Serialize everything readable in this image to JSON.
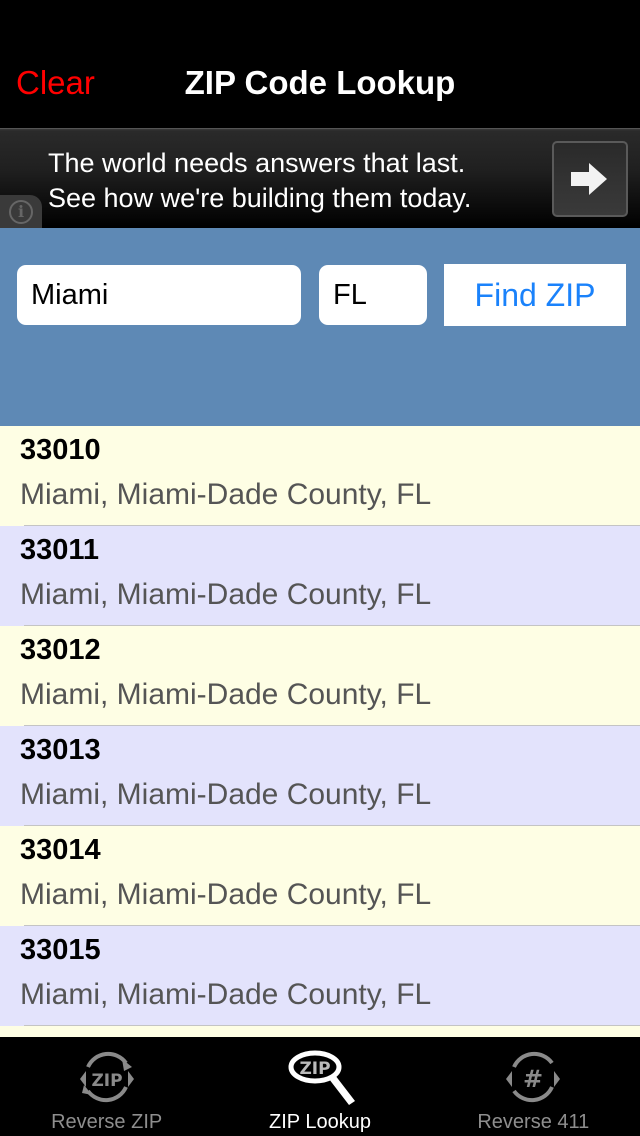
{
  "header": {
    "clear_label": "Clear",
    "title": "ZIP Code Lookup"
  },
  "ad": {
    "line1": "The world needs answers that last.",
    "line2": "See how we're building them today.",
    "arrow_icon": "right-arrow-icon",
    "info_icon": "info-icon"
  },
  "form": {
    "city_value": "Miami",
    "state_value": "FL",
    "find_label": "Find ZIP"
  },
  "colors": {
    "clear": "#ff0000",
    "form_bg": "#5e89b5",
    "find_button_text": "#1a82fb",
    "row_odd": "#fefee4",
    "row_even": "#e3e3fc"
  },
  "results": [
    {
      "zip": "33010",
      "place": "Miami, Miami-Dade County, FL"
    },
    {
      "zip": "33011",
      "place": "Miami, Miami-Dade County, FL"
    },
    {
      "zip": "33012",
      "place": "Miami, Miami-Dade County, FL"
    },
    {
      "zip": "33013",
      "place": "Miami, Miami-Dade County, FL"
    },
    {
      "zip": "33014",
      "place": "Miami, Miami-Dade County, FL"
    },
    {
      "zip": "33015",
      "place": "Miami, Miami-Dade County, FL"
    },
    {
      "zip": "",
      "place": ""
    }
  ],
  "tabs": [
    {
      "label": "Reverse ZIP",
      "icon": "reverse-zip-icon",
      "active": false
    },
    {
      "label": "ZIP Lookup",
      "icon": "zip-magnifier-icon",
      "active": true
    },
    {
      "label": "Reverse 411",
      "icon": "reverse-411-icon",
      "active": false
    }
  ]
}
